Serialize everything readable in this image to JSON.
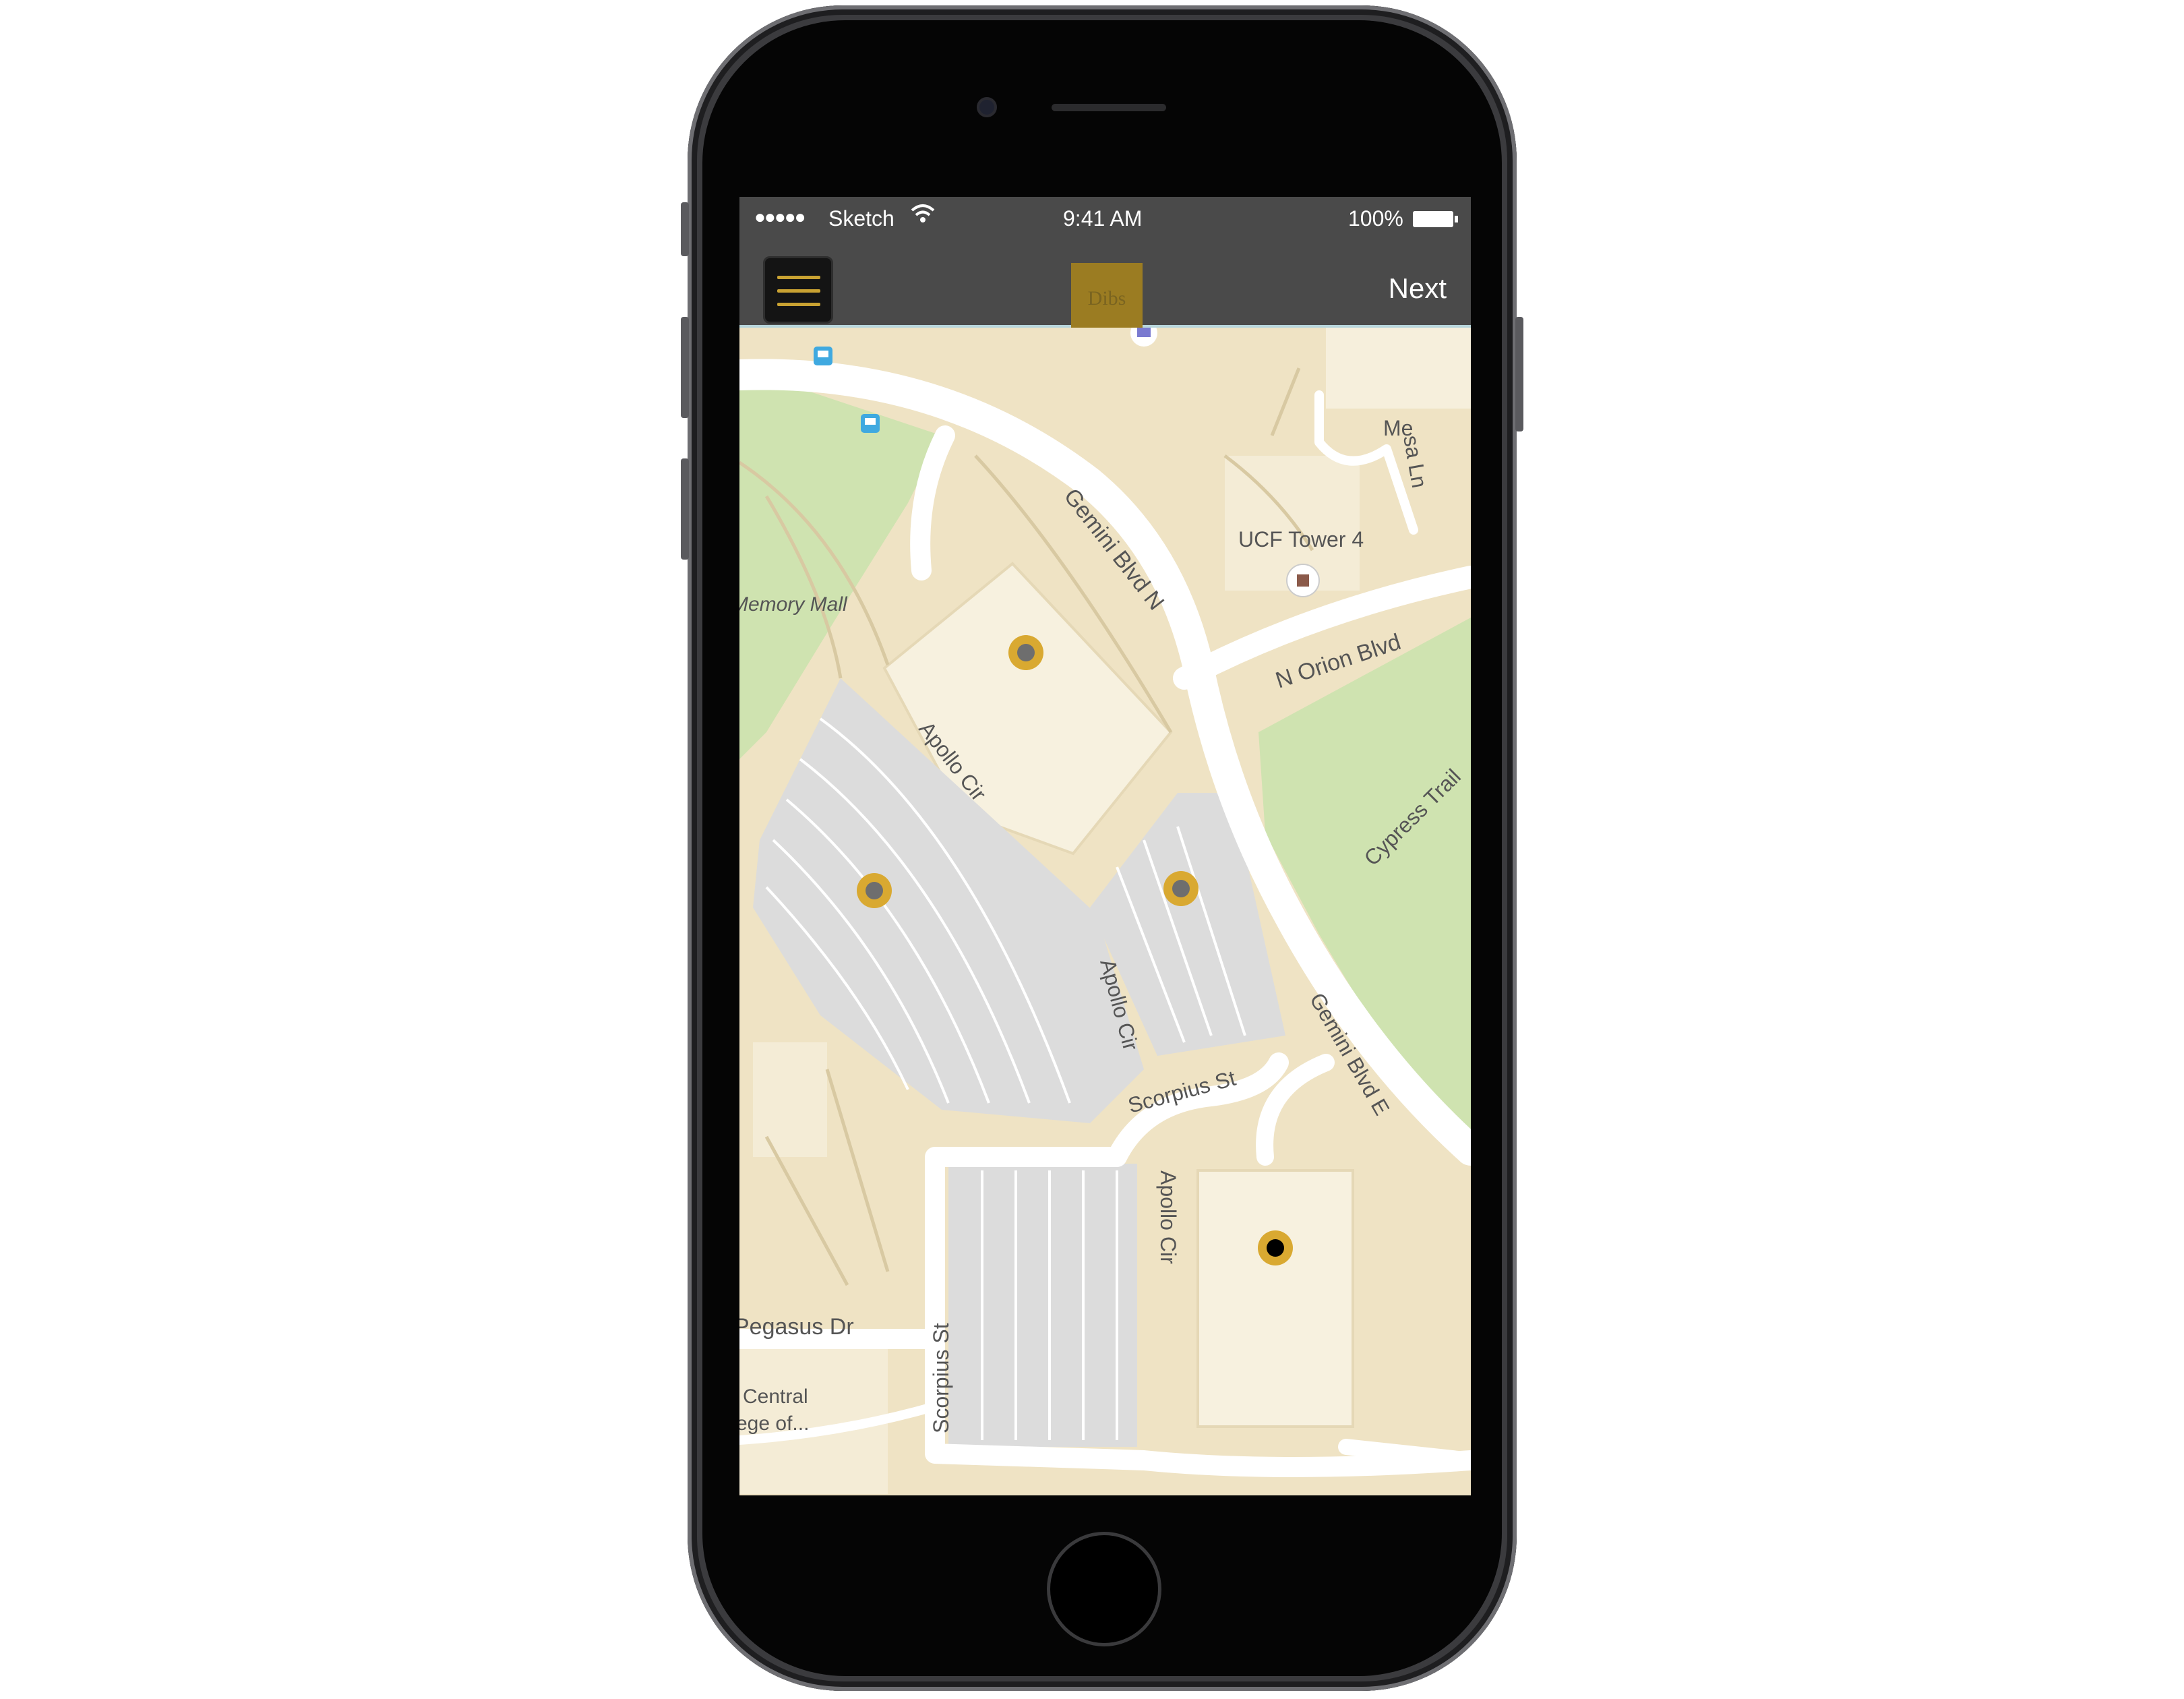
{
  "status_bar": {
    "carrier": "Sketch",
    "time": "9:41 AM",
    "battery": "100%"
  },
  "nav_bar": {
    "logo_text": "Dibs",
    "next_label": "Next",
    "menu_icon": "hamburger-menu-icon"
  },
  "map_labels": {
    "gemini_n": "Gemini Blvd N",
    "tower": "UCF Tower 4",
    "orion": "N Orion Blvd",
    "mall": "Memory Mall",
    "apollo1": "Apollo Cir",
    "apollo2": "Apollo Cir",
    "apollo3": "Apollo Cir",
    "cypress": "Cypress Trail",
    "gemini_e": "Gemini Blvd E",
    "scorpius1": "Scorpius St",
    "scorpius2": "Scorpius St",
    "pegasus": "Pegasus Dr",
    "central1": "Central",
    "central2": "ege of...",
    "mesa1": "Me",
    "mesa2": "sa Ln"
  },
  "colors": {
    "accent": "#d9a931",
    "nav": "#4a4a4a",
    "map_bg": "#efe3c4",
    "parking": "#dcdcdc",
    "park": "#cfe3b0"
  }
}
